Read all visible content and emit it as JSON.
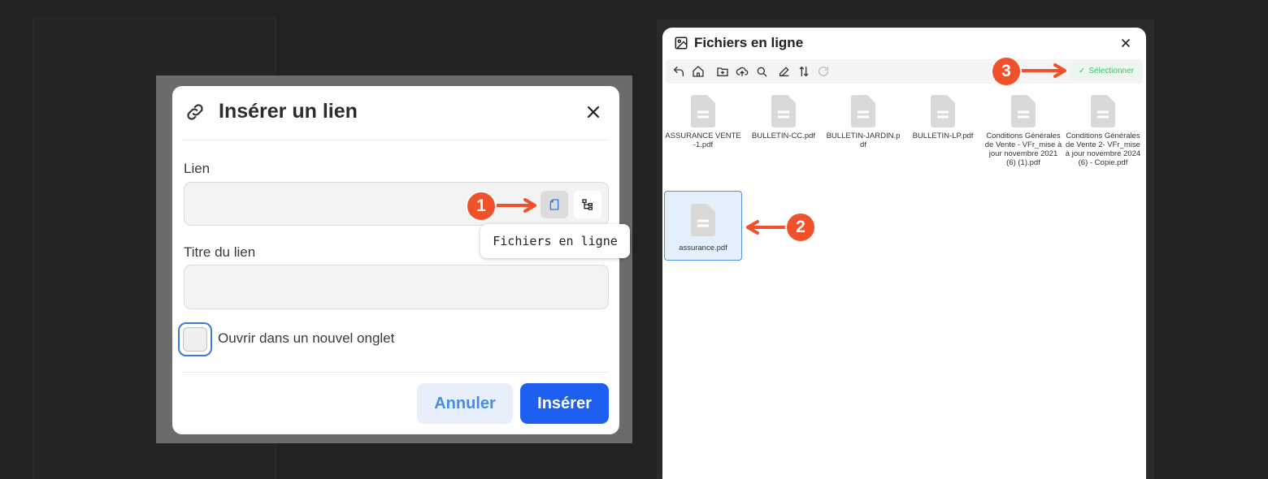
{
  "link_dialog": {
    "title": "Insérer un lien",
    "link_label": "Lien",
    "link_value": "",
    "title_label": "Titre du lien",
    "title_value": "",
    "new_tab_label": "Ouvrir dans un nouvel onglet",
    "new_tab_checked": false,
    "cancel_label": "Annuler",
    "insert_label": "Insérer",
    "tooltip": "Fichiers en ligne",
    "icons": [
      "link-icon",
      "close-icon",
      "file-browser-icon",
      "tree-icon"
    ]
  },
  "annotations": {
    "badge_1": "1",
    "badge_2": "2",
    "badge_3": "3",
    "color": "#f0502a"
  },
  "file_browser": {
    "title": "Fichiers en ligne",
    "select_label": "Sélectionner",
    "toolbar_icons": [
      "undo-icon",
      "home-icon",
      "new-folder-icon",
      "upload-icon",
      "search-icon",
      "edit-icon",
      "sort-icon",
      "refresh-icon"
    ],
    "files": [
      {
        "name": "ASSURANCE VENTE-1.pdf",
        "selected": false
      },
      {
        "name": "BULLETIN-CC.pdf",
        "selected": false
      },
      {
        "name": "BULLETIN-JARDIN.pdf",
        "selected": false
      },
      {
        "name": "BULLETIN-LP.pdf",
        "selected": false
      },
      {
        "name": "Conditions Générales de Vente - VFr_mise à jour novembre 2021 (6) (1).pdf",
        "selected": false
      },
      {
        "name": "Conditions Générales de Vente 2- VFr_mise à jour novembre 2024 (6) - Copie.pdf",
        "selected": false
      },
      {
        "name": "assurance.pdf",
        "selected": true
      }
    ]
  },
  "colors": {
    "primary": "#1d5ff0",
    "select_green": "#3fbf6a",
    "selection_blue": "#4f8fe0"
  }
}
